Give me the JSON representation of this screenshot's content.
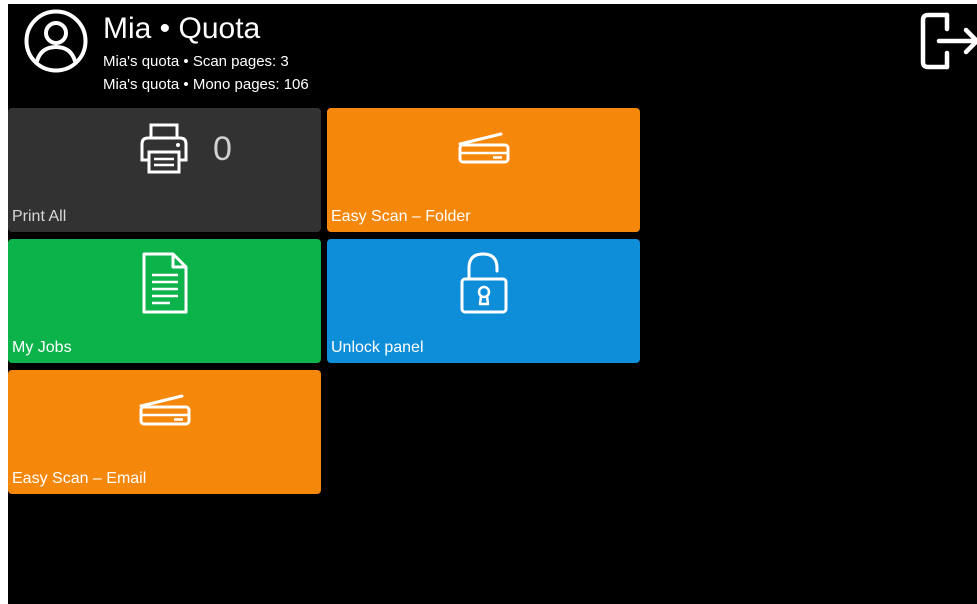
{
  "header": {
    "title": "Mia • Quota",
    "quota_scan": "Mia's quota • Scan pages: 3",
    "quota_mono": "Mia's quota • Mono pages: 106"
  },
  "tiles": [
    {
      "label": "Print All",
      "icon": "printer-icon",
      "count": "0",
      "color": "#323232"
    },
    {
      "label": "Easy Scan – Folder",
      "icon": "scanner-icon",
      "color": "#f5870a"
    },
    {
      "label": "My Jobs",
      "icon": "document-icon",
      "color": "#0cb24a"
    },
    {
      "label": "Unlock panel",
      "icon": "unlocked-padlock-icon",
      "color": "#0e8dd8"
    },
    {
      "label": "Easy Scan – Email",
      "icon": "scanner-icon",
      "color": "#f5870a"
    }
  ],
  "icons": {
    "avatar": "user-avatar-icon",
    "logout": "logout-icon"
  },
  "colors": {
    "background": "#000000",
    "text": "#ffffff"
  }
}
